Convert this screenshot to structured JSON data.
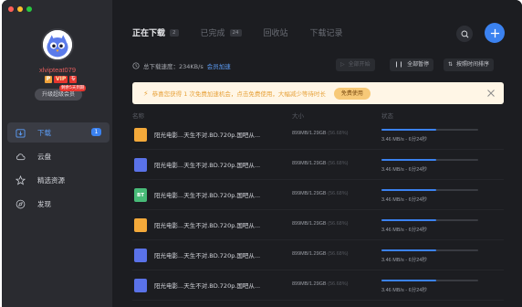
{
  "sidebar": {
    "username": "xlvipteat079",
    "badges": {
      "p": "P",
      "vip": "VIP",
      "zhuan": "专"
    },
    "expire_tag": "剩余5天到期",
    "upgrade_label": "升级超级会员",
    "items": [
      {
        "label": "下载",
        "icon": "download-icon",
        "count": "1",
        "active": true
      },
      {
        "label": "云盘",
        "icon": "cloud-icon"
      },
      {
        "label": "精选资源",
        "icon": "star-icon"
      },
      {
        "label": "发现",
        "icon": "compass-icon"
      }
    ]
  },
  "tabs": [
    {
      "label": "正在下载",
      "count": "2",
      "active": true
    },
    {
      "label": "已完成",
      "count": "24"
    },
    {
      "label": "回收站"
    },
    {
      "label": "下载记录"
    }
  ],
  "speed": {
    "label": "总下载速度：234KB/s",
    "link": "会员加速"
  },
  "toolbar": {
    "start_all": "全部开始",
    "pause_all": "全部暂停",
    "sort": "按照时间排序"
  },
  "notice": {
    "text": "恭喜您获得 1 次免费加速机会，点击免费使用，大幅减少等待时长",
    "button": "免费使用"
  },
  "columns": {
    "name": "名称",
    "size": "大小",
    "status": "状态"
  },
  "downloads": [
    {
      "icon": "folder",
      "icon_label": "",
      "name": "阳光电影...天生不对.BD.720p.国吧从...",
      "size": "899MB/1.29GB",
      "percent": "(56.68%)",
      "progress": 0.5668,
      "status": "3.46 MB/s - 6分24秒"
    },
    {
      "icon": "video",
      "icon_label": "",
      "name": "阳光电影...天生不对.BD.720p.国吧从...",
      "size": "899MB/1.29GB",
      "percent": "(56.68%)",
      "progress": 0.5668,
      "status": "3.46 MB/s - 6分24秒"
    },
    {
      "icon": "bt",
      "icon_label": "BT",
      "name": "阳光电影...天生不对.BD.720p.国吧从...",
      "size": "899MB/1.29GB",
      "percent": "(56.68%)",
      "progress": 0.5668,
      "status": "3.46 MB/s - 6分24秒"
    },
    {
      "icon": "folder",
      "icon_label": "",
      "name": "阳光电影...天生不对.BD.720p.国吧从...",
      "size": "899MB/1.29GB",
      "percent": "(56.68%)",
      "progress": 0.5668,
      "status": "3.46 MB/s - 6分24秒"
    },
    {
      "icon": "video",
      "icon_label": "",
      "name": "阳光电影...天生不对.BD.720p.国吧从...",
      "size": "899MB/1.29GB",
      "percent": "(56.68%)",
      "progress": 0.5668,
      "status": "3.46 MB/s - 6分24秒"
    },
    {
      "icon": "video",
      "icon_label": "",
      "name": "阳光电影...天生不对.BD.720p.国吧从...",
      "size": "899MB/1.29GB",
      "percent": "(56.68%)",
      "progress": 0.5668,
      "status": "3.46 MB/s - 6分24秒"
    }
  ],
  "colors": {
    "accent": "#3b82f0",
    "notice_bg": "#fff6e6",
    "notice_text": "#e7a23a",
    "username": "#e25c5c"
  }
}
